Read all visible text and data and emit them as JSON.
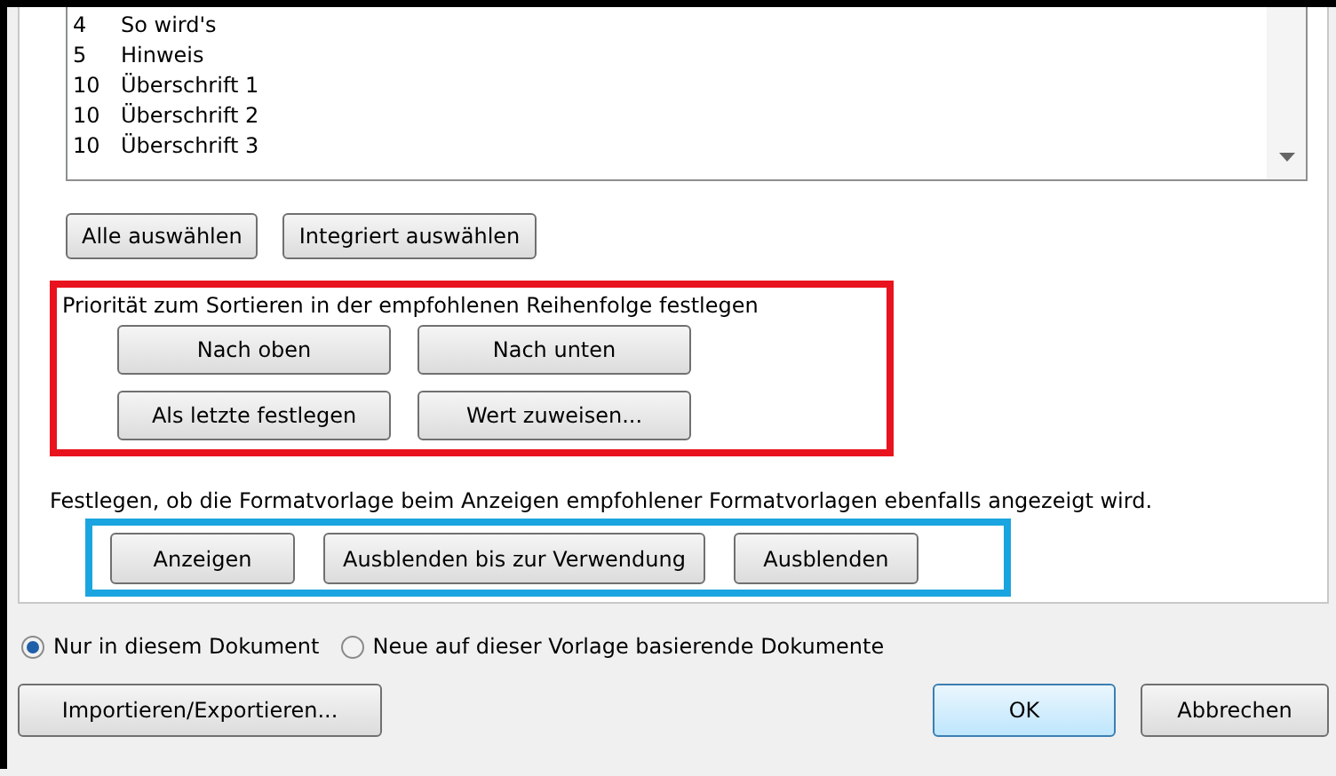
{
  "style_list": {
    "rows": [
      {
        "priority": "4",
        "name": "So wird's"
      },
      {
        "priority": "5",
        "name": "Hinweis"
      },
      {
        "priority": "10",
        "name": "Überschrift 1"
      },
      {
        "priority": "10",
        "name": "Überschrift 2"
      },
      {
        "priority": "10",
        "name": "Überschrift 3"
      }
    ]
  },
  "select_buttons": [
    "Alle auswählen",
    "Integriert auswählen"
  ],
  "priority_section": {
    "label": "Priorität zum Sortieren in der empfohlenen Reihenfolge festlegen",
    "buttons": [
      "Nach oben",
      "Nach unten",
      "Als letzte festlegen",
      "Wert zuweisen..."
    ]
  },
  "visibility_section": {
    "label": "Festlegen, ob die Formatvorlage beim Anzeigen empfohlener Formatvorlagen ebenfalls angezeigt wird.",
    "buttons": [
      "Anzeigen",
      "Ausblenden bis zur Verwendung",
      "Ausblenden"
    ]
  },
  "scope_options": [
    {
      "label": "Nur in diesem Dokument",
      "selected": true
    },
    {
      "label": "Neue auf dieser Vorlage basierende Dokumente",
      "selected": false
    }
  ],
  "footer": {
    "import_button": "Importieren/Exportieren...",
    "ok_button": "OK",
    "cancel_button": "Abbrechen"
  }
}
